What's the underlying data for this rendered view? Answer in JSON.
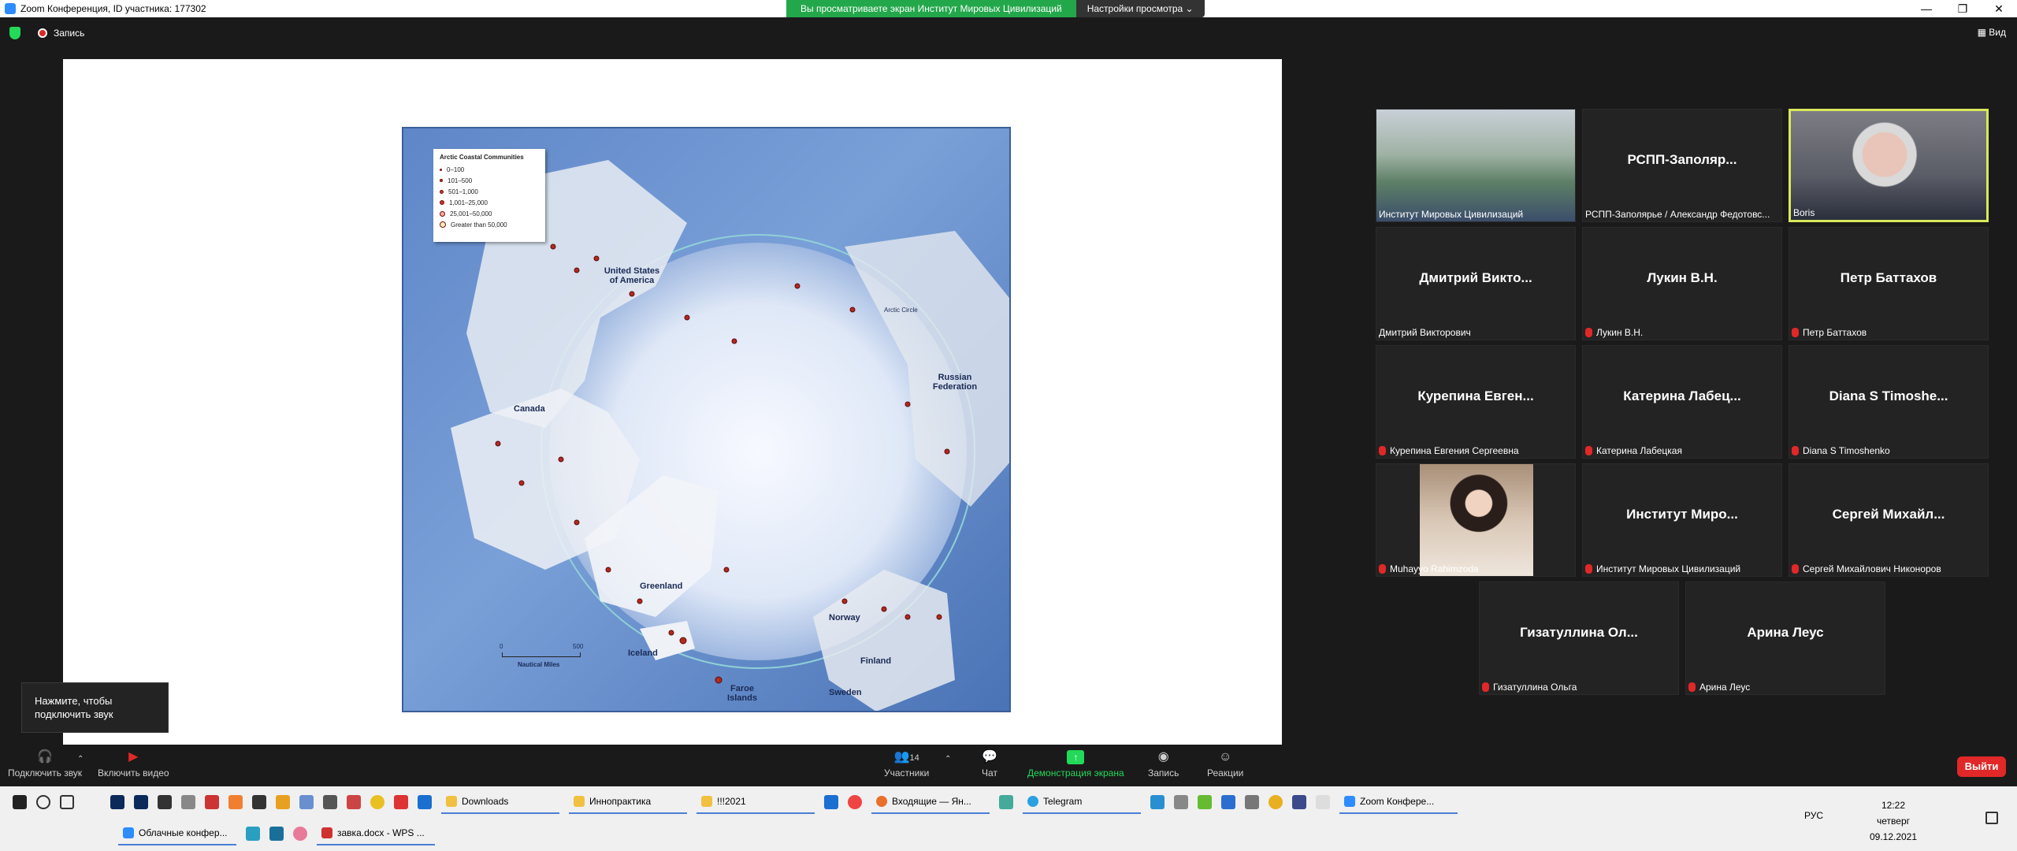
{
  "window": {
    "title": "Zoom Конференция, ID участника: 177302",
    "share_banner": "Вы просматриваете экран Институт Мировых Цивилизаций",
    "view_settings": "Настройки просмотра ⌄",
    "controls": [
      "—",
      "❐",
      "✕"
    ]
  },
  "zoom_top": {
    "record_label": "Запись",
    "view_label": "Вид"
  },
  "map": {
    "legend_title": "Arctic Coastal Communities",
    "legend_items": [
      "0–100",
      "101–500",
      "501–1,000",
      "1,001–25,000",
      "25,001–50,000",
      "Greater than 50,000"
    ],
    "labels": {
      "usa": "United States of America",
      "canada": "Canada",
      "russia": "Russian Federation",
      "greenland": "Greenland",
      "iceland": "Iceland",
      "norway": "Norway",
      "finland": "Finland",
      "sweden": "Sweden",
      "faroe": "Faroe Islands",
      "arctic_circle": "Arctic Circle",
      "scale_0": "0",
      "scale_500": "500",
      "scale_units": "Nautical Miles"
    }
  },
  "participants": [
    {
      "big": "",
      "name": "Институт Мировых Цивилизаций",
      "muted": false,
      "video": "conference"
    },
    {
      "big": "РСПП-Заполяр...",
      "name": "РСПП-Заполярье / Александр Федотовс...",
      "muted": false,
      "video": ""
    },
    {
      "big": "",
      "name": "Boris",
      "muted": false,
      "video": "boris"
    },
    {
      "big": "Дмитрий Викто...",
      "name": "Дмитрий Викторович",
      "muted": false,
      "video": ""
    },
    {
      "big": "Лукин В.Н.",
      "name": "Лукин В.Н.",
      "muted": true,
      "video": ""
    },
    {
      "big": "Петр Баттахов",
      "name": "Петр Баттахов",
      "muted": true,
      "video": ""
    },
    {
      "big": "Курепина Евген...",
      "name": "Курепина Евгения Сергеевна",
      "muted": true,
      "video": ""
    },
    {
      "big": "Катерина Лабец...",
      "name": "Катерина Лабецкая",
      "muted": true,
      "video": ""
    },
    {
      "big": "Diana S Timoshe...",
      "name": "Diana S Timoshenko",
      "muted": true,
      "video": ""
    },
    {
      "big": "",
      "name": "Muhayyo Rahimzoda",
      "muted": true,
      "video": "girl"
    },
    {
      "big": "Институт Миро...",
      "name": "Институт Мировых Цивилизаций",
      "muted": true,
      "video": ""
    },
    {
      "big": "Сергей Михайл...",
      "name": "Сергей Михайлович Никоноров",
      "muted": true,
      "video": ""
    },
    {
      "big": "Гизатуллина Ол...",
      "name": "Гизатуллина Ольга",
      "muted": true,
      "video": ""
    },
    {
      "big": "Арина Леус",
      "name": "Арина Леус",
      "muted": true,
      "video": ""
    }
  ],
  "tooltip": {
    "text": "Нажмите, чтобы подключить звук"
  },
  "toolbar": {
    "audio": "Подключить звук",
    "video": "Включить видео",
    "participants": "Участники",
    "participants_count": "14",
    "chat": "Чат",
    "share": "Демонстрация экрана",
    "record": "Запись",
    "reactions": "Реакции",
    "exit": "Выйти"
  },
  "taskbar": {
    "row1": [
      "Downloads",
      "Иннопрактика",
      "!!!2021",
      "Входящие — Ян...",
      "Telegram",
      "Zoom Конфере..."
    ],
    "row2": [
      "Облачные конфер...",
      "завка.docx - WPS ..."
    ],
    "lang": "РУС",
    "time": "12:22",
    "day": "четверг",
    "date": "09.12.2021"
  }
}
